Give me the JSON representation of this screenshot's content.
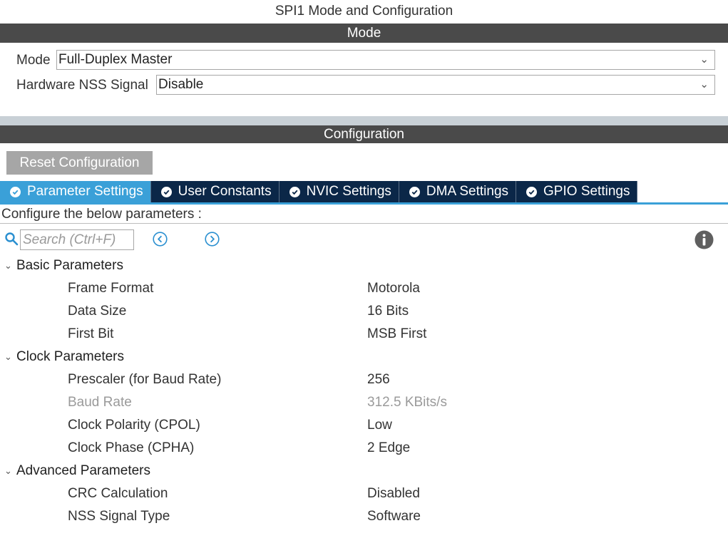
{
  "window": {
    "title": "SPI1 Mode and Configuration"
  },
  "mode_section": {
    "header": "Mode",
    "fields": [
      {
        "label": "Mode",
        "value": "Full-Duplex Master"
      },
      {
        "label": "Hardware NSS Signal",
        "value": "Disable"
      }
    ]
  },
  "config_section": {
    "header": "Configuration",
    "reset_label": "Reset Configuration",
    "tabs": [
      {
        "label": "Parameter Settings",
        "active": true
      },
      {
        "label": "User Constants",
        "active": false
      },
      {
        "label": "NVIC Settings",
        "active": false
      },
      {
        "label": "DMA Settings",
        "active": false
      },
      {
        "label": "GPIO Settings",
        "active": false
      }
    ],
    "instruction": "Configure the below parameters :",
    "search_placeholder": "Search (Ctrl+F)",
    "groups": [
      {
        "label": "Basic Parameters",
        "params": [
          {
            "name": "Frame Format",
            "value": "Motorola"
          },
          {
            "name": "Data Size",
            "value": "16 Bits"
          },
          {
            "name": "First Bit",
            "value": "MSB First"
          }
        ]
      },
      {
        "label": "Clock Parameters",
        "params": [
          {
            "name": "Prescaler (for Baud Rate)",
            "value": "256"
          },
          {
            "name": "Baud Rate",
            "value": "312.5 KBits/s",
            "disabled": true
          },
          {
            "name": "Clock Polarity (CPOL)",
            "value": "Low"
          },
          {
            "name": "Clock Phase (CPHA)",
            "value": "2 Edge"
          }
        ]
      },
      {
        "label": "Advanced Parameters",
        "params": [
          {
            "name": "CRC Calculation",
            "value": "Disabled"
          },
          {
            "name": "NSS Signal Type",
            "value": "Software"
          }
        ]
      }
    ]
  },
  "colors": {
    "section_header_bg": "#4a4a4a",
    "tab_active_bg": "#3aa0d8",
    "tab_inactive_bg": "#0b2748",
    "reset_button_bg": "#a6a6a6",
    "accent_blue": "#3aa0d8"
  },
  "icons": {
    "search": "search-icon",
    "prev": "chevron-left-circle-icon",
    "next": "chevron-right-circle-icon",
    "info": "info-icon",
    "tab_check": "check-circle-icon"
  }
}
